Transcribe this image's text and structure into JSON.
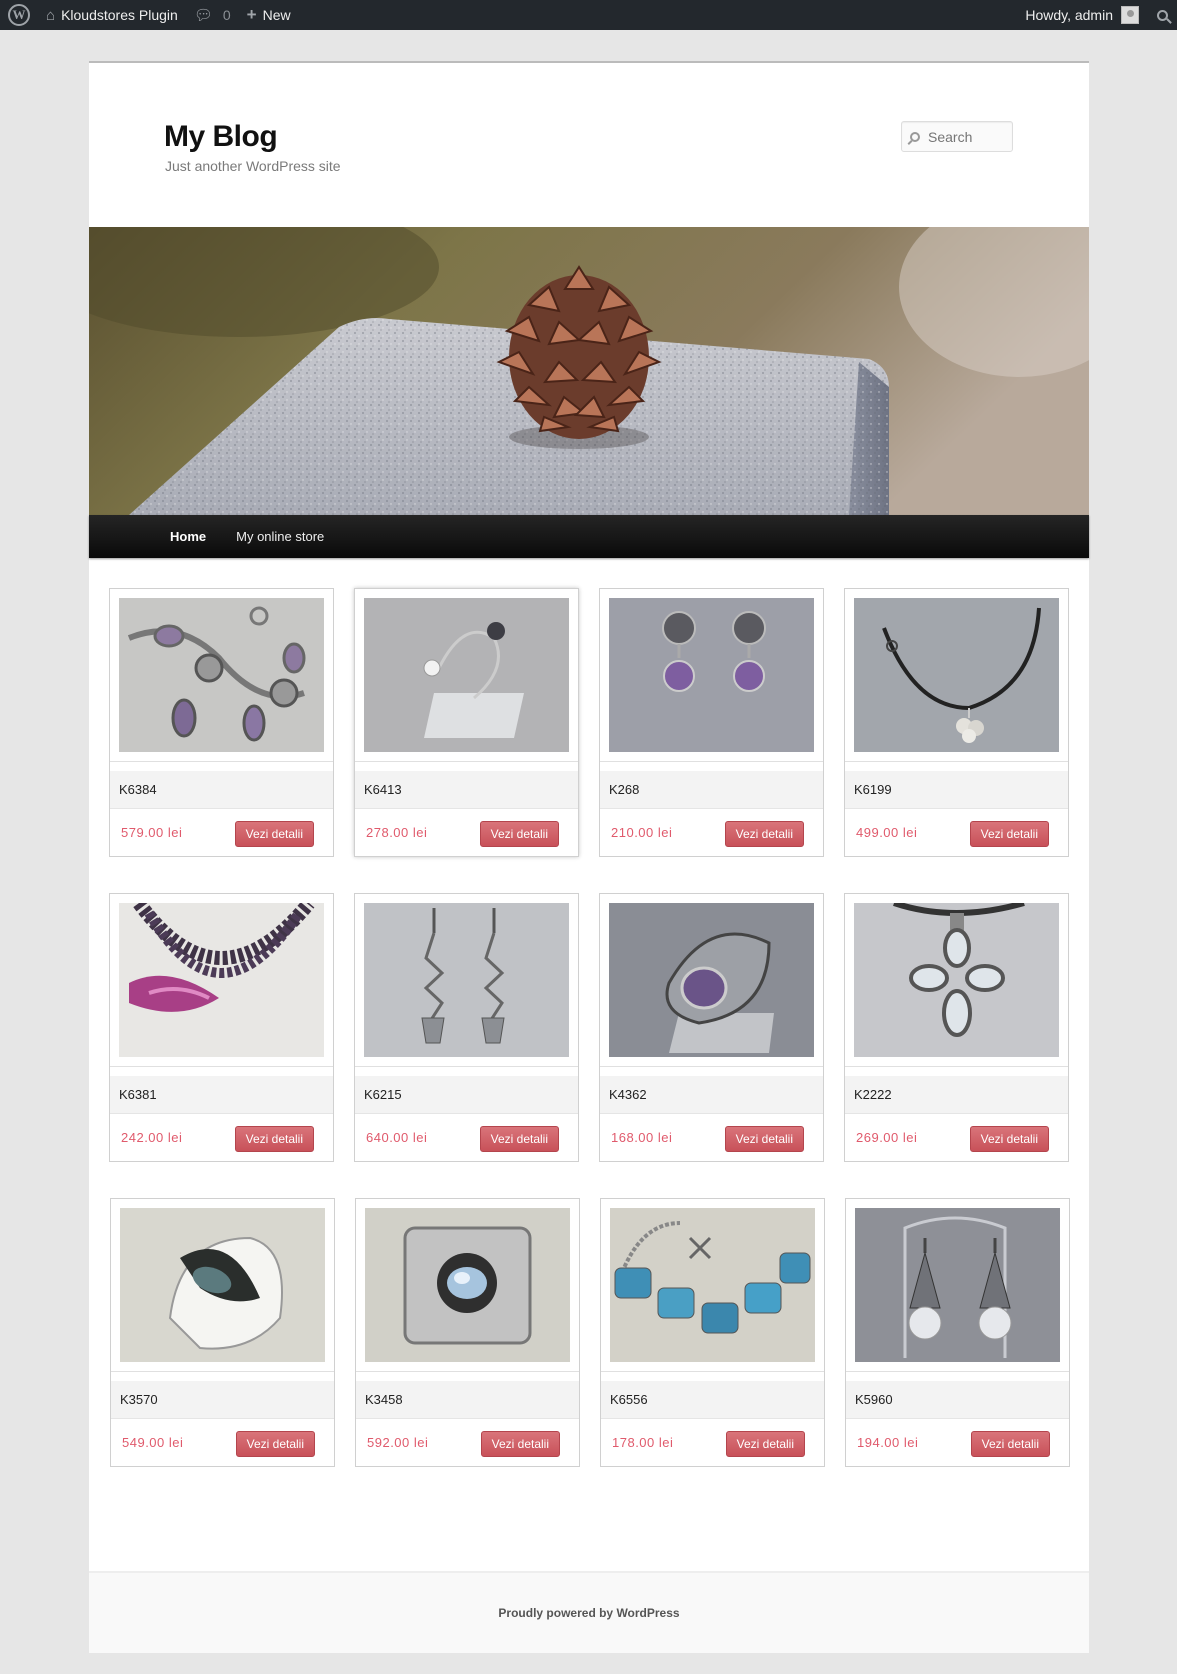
{
  "adminbar": {
    "site_name": "Kloudstores Plugin",
    "comments_count": "0",
    "new_label": "New",
    "howdy": "Howdy, admin"
  },
  "header": {
    "site_title": "My Blog",
    "site_description": "Just another WordPress site",
    "search_placeholder": "Search"
  },
  "nav": {
    "items": [
      {
        "label": "Home",
        "current": true
      },
      {
        "label": "My online store",
        "current": false
      }
    ]
  },
  "products": [
    {
      "sku": "K6384",
      "price": "579.00 lei",
      "button": "Vezi detalii",
      "image": "bracelet-amethyst"
    },
    {
      "sku": "K6413",
      "price": "278.00 lei",
      "button": "Vezi detalii",
      "image": "ring-pearl"
    },
    {
      "sku": "K268",
      "price": "210.00 lei",
      "button": "Vezi detalii",
      "image": "earrings-amethyst"
    },
    {
      "sku": "K6199",
      "price": "499.00 lei",
      "button": "Vezi detalii",
      "image": "necklace-flower"
    },
    {
      "sku": "K6381",
      "price": "242.00 lei",
      "button": "Vezi detalii",
      "image": "necklace-pearls"
    },
    {
      "sku": "K6215",
      "price": "640.00 lei",
      "button": "Vezi detalii",
      "image": "earrings-long"
    },
    {
      "sku": "K4362",
      "price": "168.00 lei",
      "button": "Vezi detalii",
      "image": "ring-amethyst"
    },
    {
      "sku": "K2222",
      "price": "269.00 lei",
      "button": "Vezi detalii",
      "image": "pendant-cross"
    },
    {
      "sku": "K3570",
      "price": "549.00 lei",
      "button": "Vezi detalii",
      "image": "ring-labradorite"
    },
    {
      "sku": "K3458",
      "price": "592.00 lei",
      "button": "Vezi detalii",
      "image": "brooch-moonstone"
    },
    {
      "sku": "K6556",
      "price": "178.00 lei",
      "button": "Vezi detalii",
      "image": "bracelet-glass"
    },
    {
      "sku": "K5960",
      "price": "194.00 lei",
      "button": "Vezi detalii",
      "image": "earrings-crystal"
    }
  ],
  "footer": {
    "credit": "Proudly powered by WordPress"
  },
  "colors": {
    "price": "#e05a6c",
    "button": "#c85159",
    "nav_bg": "#111111",
    "adminbar_bg": "#23282d"
  }
}
